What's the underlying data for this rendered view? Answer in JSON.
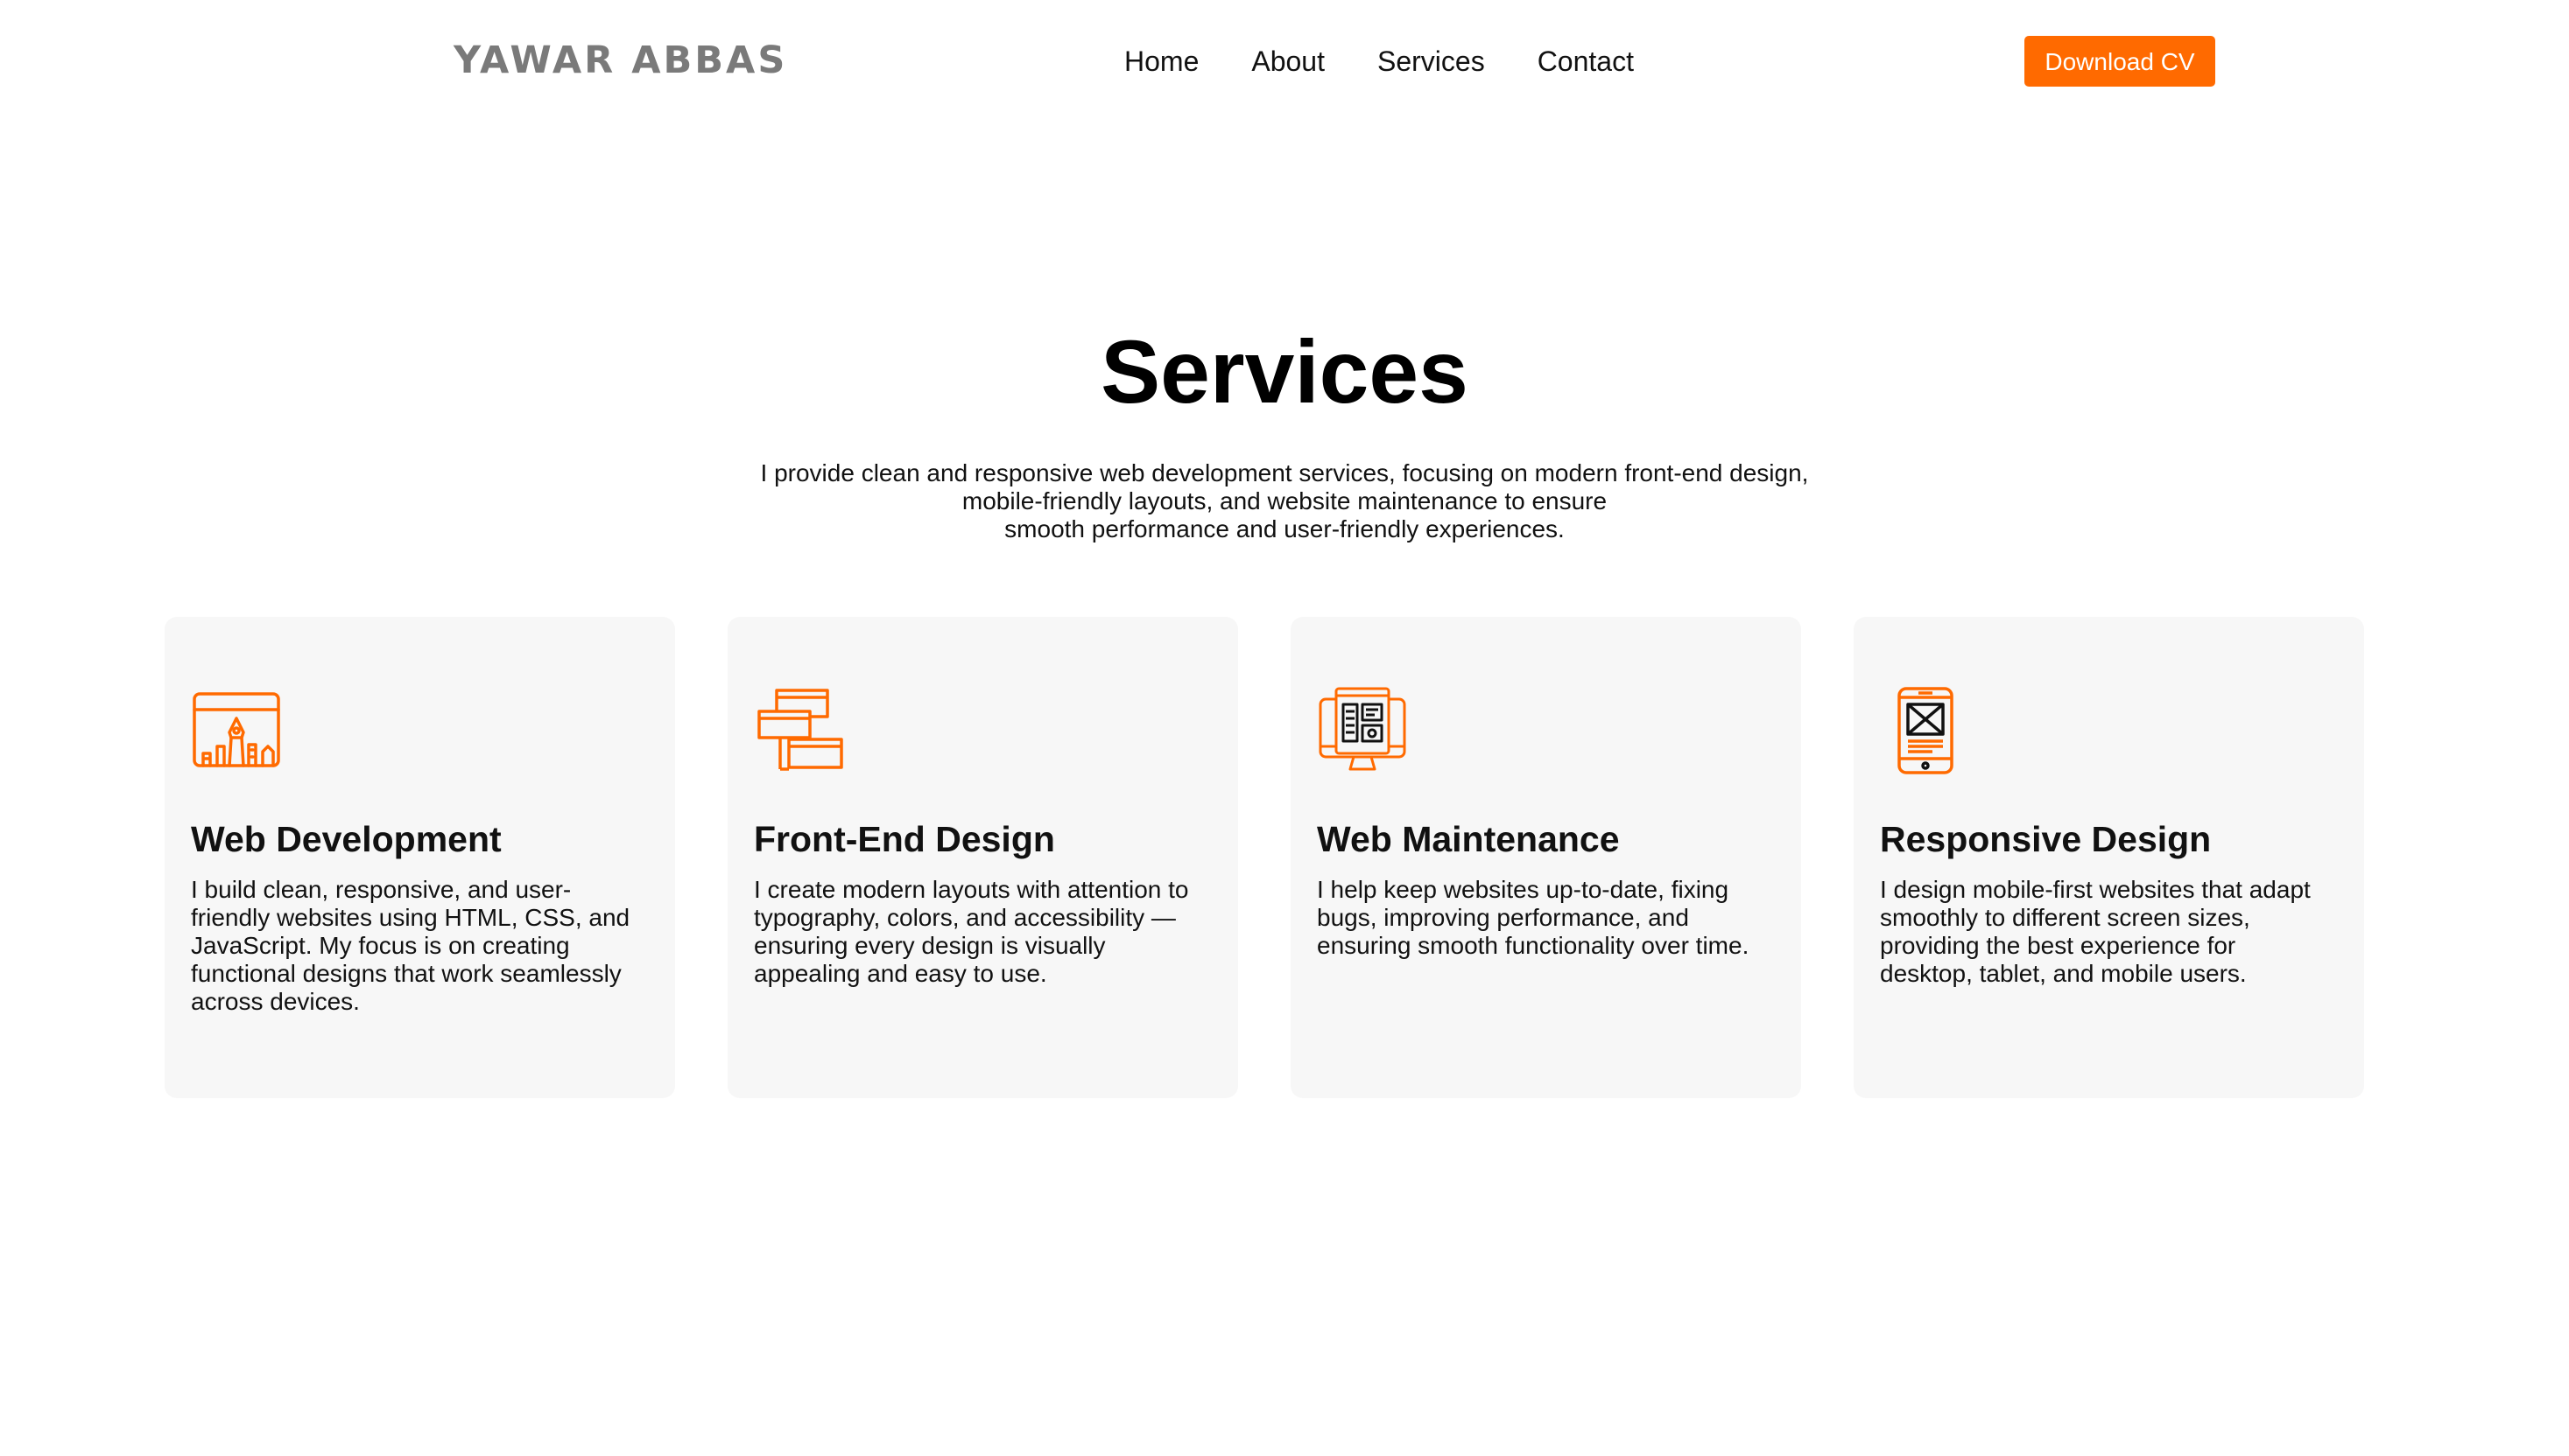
{
  "header": {
    "logo": "YAWAR ABBAS",
    "nav": [
      "Home",
      "About",
      "Services",
      "Contact"
    ],
    "cta_label": "Download CV"
  },
  "colors": {
    "accent": "#ff6a00",
    "card_bg": "#f7f7f7",
    "logo": "#7a7a7a"
  },
  "services": {
    "title": "Services",
    "description_lines": [
      "I provide clean and responsive web development services, focusing on modern front-end design,",
      "mobile-friendly layouts, and website maintenance to ensure",
      "smooth performance and user-friendly experiences."
    ],
    "cards": [
      {
        "icon": "web-development-icon",
        "title": "Web Development",
        "text_lines": [
          "I build clean, responsive, and user-",
          "friendly websites using HTML, CSS, and",
          "JavaScript. My focus is on creating",
          "functional designs that work seamlessly",
          "across devices."
        ]
      },
      {
        "icon": "front-end-design-icon",
        "title": "Front-End Design",
        "text_lines": [
          "I create modern layouts with attention to",
          "typography, colors, and accessibility —",
          "ensuring every design is visually",
          "appealing and easy to use."
        ]
      },
      {
        "icon": "web-maintenance-icon",
        "title": "Web Maintenance",
        "text_lines": [
          "I help keep websites up-to-date, fixing",
          "bugs, improving performance, and",
          "ensuring smooth functionality over time."
        ]
      },
      {
        "icon": "responsive-design-icon",
        "title": "Responsive Design",
        "text_lines": [
          "I design mobile-first websites that adapt",
          "smoothly to different screen sizes,",
          "providing the best experience for",
          "desktop, tablet, and mobile users."
        ]
      }
    ]
  }
}
